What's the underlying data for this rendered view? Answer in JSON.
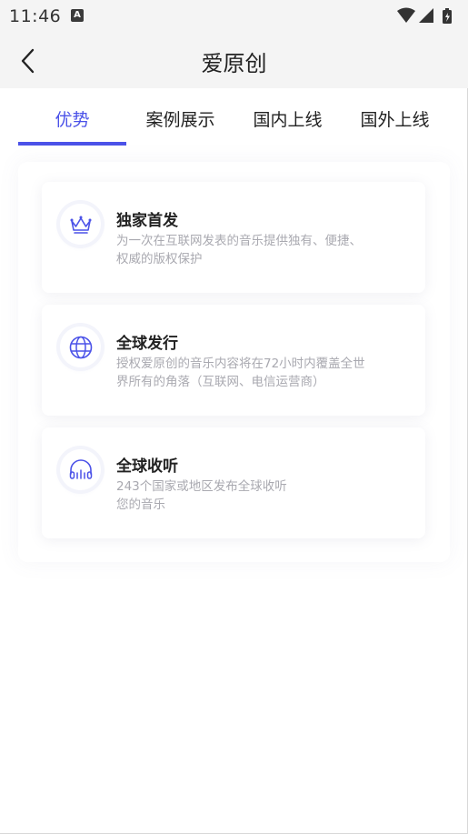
{
  "status_bar": {
    "time": "11:46",
    "notification_icon": "a-letter-icon",
    "icons": [
      "wifi-icon",
      "signal-icon",
      "battery-charging-icon"
    ]
  },
  "nav": {
    "back_icon": "chevron-left-icon",
    "title": "爱原创"
  },
  "tabs": [
    {
      "label": "优势",
      "active": true
    },
    {
      "label": "案例展示",
      "active": false
    },
    {
      "label": "国内上线",
      "active": false
    },
    {
      "label": "国外上线",
      "active": false
    }
  ],
  "colors": {
    "accent": "#4b52e8",
    "text_primary": "#222222",
    "text_secondary": "#a9a9b0",
    "header_bg": "#f4f4f4"
  },
  "cards": [
    {
      "icon": "crown-icon",
      "title": "独家首发",
      "desc_line1": "为一次在互联网发表的音乐提供独有、便捷、",
      "desc_line2": "权威的版权保护"
    },
    {
      "icon": "globe-icon",
      "title": "全球发行",
      "desc_line1": "授权爱原创的音乐内容将在72小时内覆盖全世",
      "desc_line2": "界所有的角落（互联网、电信运营商）"
    },
    {
      "icon": "headphones-icon",
      "title": "全球收听",
      "desc_line1": "243个国家或地区发布全球收听",
      "desc_line2": "您的音乐"
    }
  ]
}
